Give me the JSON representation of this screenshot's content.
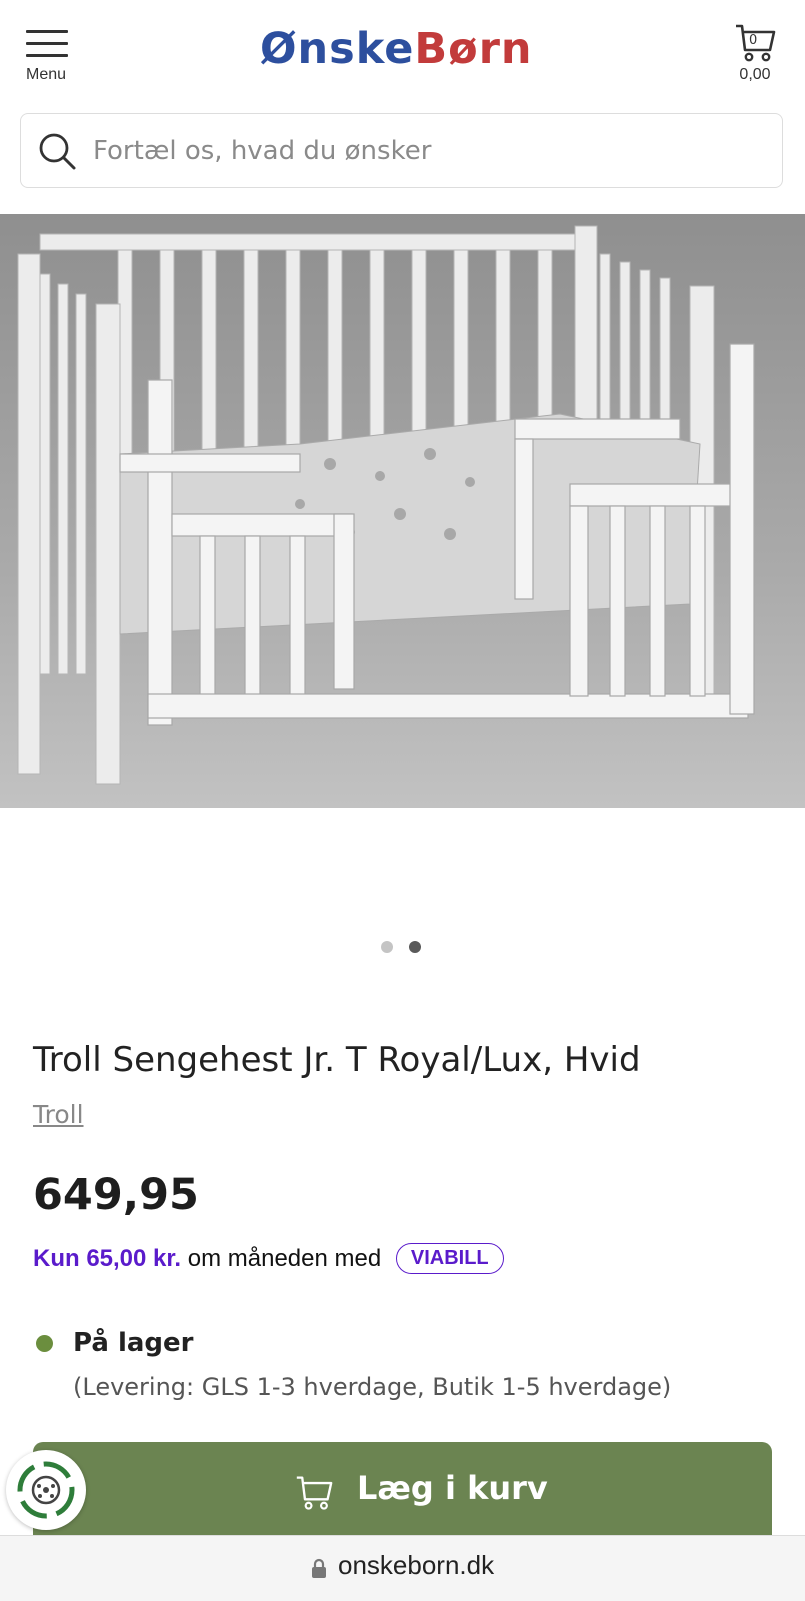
{
  "header": {
    "menu_label": "Menu",
    "logo": {
      "part1": "Ønske",
      "part2": "Børn"
    },
    "cart_count": "0",
    "cart_total": "0,00"
  },
  "search": {
    "placeholder": "Fortæl os, hvad du ønsker"
  },
  "gallery": {
    "current_slide": 2,
    "total_slides": 2
  },
  "product": {
    "title": "Troll Sengehest Jr. T Royal/Lux, Hvid",
    "brand": "Troll",
    "price": "649,95",
    "finance": {
      "amount": "Kun 65,00 kr.",
      "text": "om måneden med",
      "provider": "VIABILL"
    },
    "stock_status": "På lager",
    "delivery": "(Levering: GLS 1-3 hverdage, Butik 1-5 hverdage)",
    "add_to_cart": "Læg i kurv"
  },
  "browser": {
    "url": "onskeborn.dk"
  },
  "colors": {
    "brand_blue": "#2d4f9e",
    "brand_red": "#c23b3b",
    "cta_green": "#6b8451",
    "stock_green": "#6b8e3e",
    "viabill_purple": "#5a1bcb"
  }
}
